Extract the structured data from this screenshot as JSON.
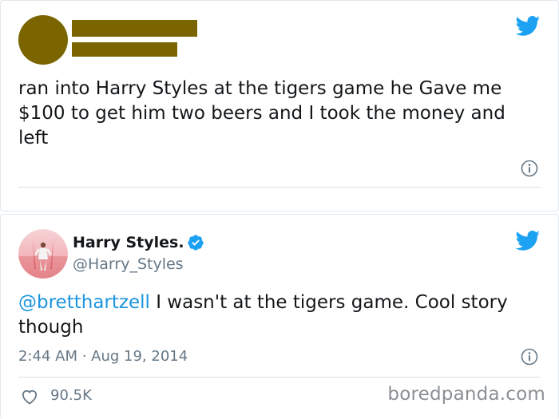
{
  "colors": {
    "redaction": "#7b6500",
    "twitter_blue": "#1da1f2",
    "link_blue": "#1b95e0",
    "text": "#14171a",
    "muted": "#657786"
  },
  "tweet1": {
    "text": "ran into Harry Styles at the tigers game he Gave me $100 to get him two beers and I took the money and left",
    "icons": [
      "twitter-bird-icon",
      "info-icon"
    ]
  },
  "tweet2": {
    "display_name": "Harry Styles.",
    "handle": "@Harry_Styles",
    "mention": "@bretthartzell",
    "text_rest": " I wasn't at the tigers game. Cool story though",
    "timestamp": "2:44 AM · Aug 19, 2014",
    "likes": "90.5K",
    "icons": [
      "twitter-bird-icon",
      "verified-badge-icon",
      "info-icon",
      "heart-icon"
    ]
  },
  "watermark": "boredpanda.com"
}
